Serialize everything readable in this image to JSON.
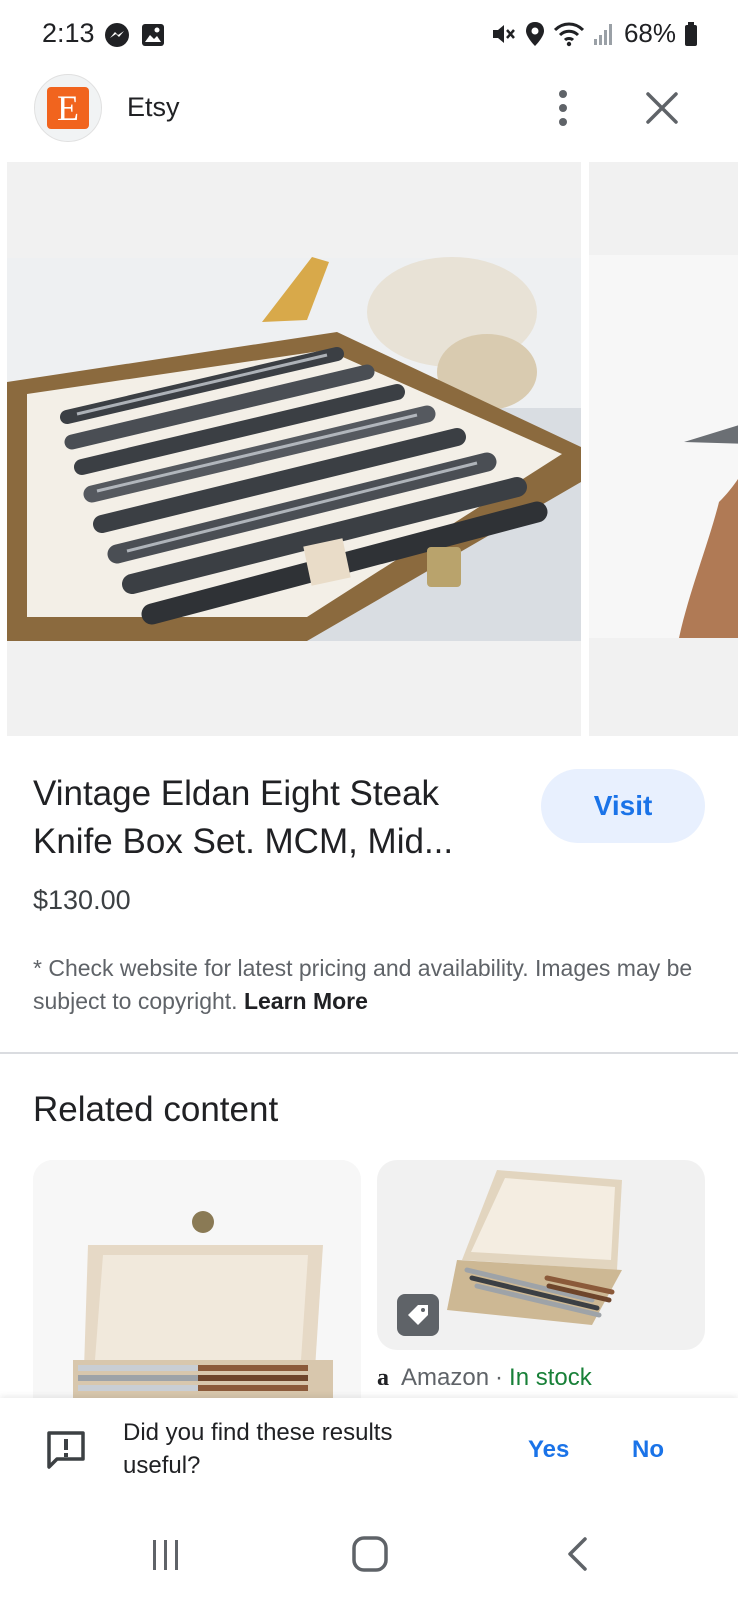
{
  "status_bar": {
    "time": "2:13",
    "battery": "68%"
  },
  "header": {
    "logo_letter": "E",
    "site_name": "Etsy"
  },
  "product": {
    "title": "Vintage Eldan Eight Steak Knife Box Set. MCM, Mid...",
    "visit_label": "Visit",
    "price": "$130.00",
    "disclaimer": "* Check website for latest pricing and availability. Images may be subject to copyright.",
    "learn_more": "Learn More"
  },
  "related": {
    "title": "Related content",
    "cards": [
      {},
      {
        "source_logo": "a",
        "source": "Amazon",
        "separator": "·",
        "stock": "In stock"
      }
    ]
  },
  "feedback": {
    "question": "Did you find these results useful?",
    "yes": "Yes",
    "no": "No"
  },
  "colors": {
    "accent": "#1a73e8",
    "visit_bg": "#e8f0fe",
    "etsy_orange": "#f1641e",
    "in_stock_green": "#188038"
  }
}
